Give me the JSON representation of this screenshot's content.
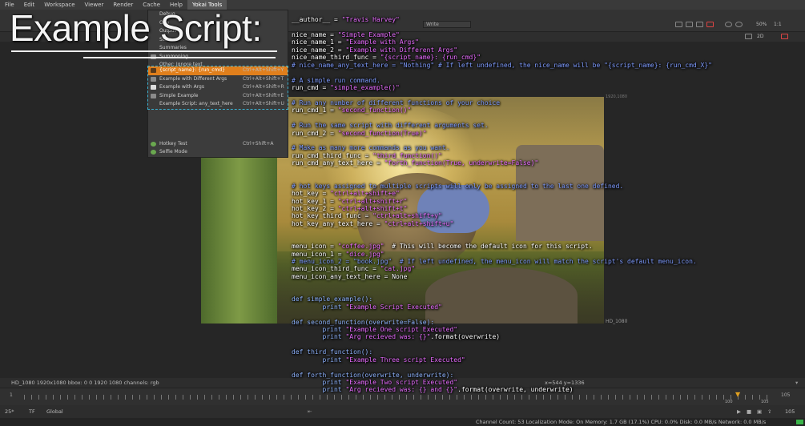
{
  "menubar": {
    "items": [
      "File",
      "Edit",
      "Workspace",
      "Viewer",
      "Render",
      "Cache",
      "Help",
      "Yokai Tools"
    ]
  },
  "overlay_title": "Example Script:",
  "dropdown": {
    "items": [
      "Debug",
      "One",
      "Output",
      "Stats",
      "Summaries",
      "Summoning",
      "Other: Ignore text"
    ]
  },
  "submenu": {
    "items": [
      {
        "label": "{script_name}: {run_cmd}",
        "shortcut": "Ctrl+Alt+Shift+Y"
      },
      {
        "label": "Example with Different Args",
        "shortcut": "Ctrl+Alt+Shift+T"
      },
      {
        "label": "Example with Args",
        "shortcut": "Ctrl+Alt+Shift+R"
      },
      {
        "label": "Simple Example",
        "shortcut": "Ctrl+Alt+Shift+E"
      },
      {
        "label": "Example Script: any_text_here",
        "shortcut": "Ctrl+Alt+Shift+U"
      }
    ],
    "extra": [
      {
        "label": "Hotkey Test",
        "shortcut": "Ctrl+Shift+A"
      },
      {
        "label": "Selfie Mode",
        "shortcut": ""
      }
    ]
  },
  "toolbar": {
    "write_label": "Write",
    "zoom": "50%",
    "ratio": "1:1",
    "view_mode": "2D"
  },
  "viewer": {
    "format_top": "1920,1080",
    "format_bottom": "HD_1080"
  },
  "code_lines": [
    "__author__ = \"Travis Harvey\"",
    "",
    "nice_name = \"Simple Example\"",
    "nice_name_1 = \"Example with Args\"",
    "nice_name_2 = \"Example with Different Args\"",
    "nice_name_third_func = \"{script_name}: {run_cmd}\"",
    "# nice_name_any_text_here = \"Nothing\" # If left undefined, the nice_name will be \"{script_name}: {run_cmd_X}\"",
    "",
    "# A simple run command.",
    "run_cmd = \"simple_example()\"",
    "",
    "# Run any number of different functions of your choice",
    "run_cmd_1 = \"second_function()\"",
    "",
    "# Run the same script with different arguments set.",
    "run_cmd_2 = \"second_function(True)\"",
    "",
    "# Make as many more commands as you want.",
    "run_cmd_third_func = \"third_function()\"",
    "run_cmd_any_text_here = \"forth_function(True, underwrite=False)\"",
    "",
    "",
    "# hot keys assigned to multiple scripts will only be assigned to the last one defined.",
    "hot_key = \"ctrl+alt+shift+e\"",
    "hot_key_1 = \"ctrl+alt+shift+r\"",
    "hot_key_2 = \"ctrl+alt+shift+t\"",
    "hot_key_third_func = \"ctrl+alt+shift+y\"",
    "hot_key_any_text_here = \"ctrl+alt+shift+u\"",
    "",
    "",
    "menu_icon = \"coffee.jpg\"  # This will become the default icon for this script.",
    "menu_icon_1 = \"dice.jpg\"",
    "# menu_icon_2 = \"book.jpg\"  # If left undefined, the menu_icon will match the script's default menu_icon.",
    "menu_icon_third_func = \"cat.jpg\"",
    "menu_icon_any_text_here = None",
    "",
    "",
    "def simple_example():",
    "        print \"Example Script Executed\"",
    "",
    "def second_function(overwrite=False):",
    "        print \"Example One script Executed\"",
    "        print \"Arg recieved was: {}\".format(overwrite)",
    "",
    "def third_function():",
    "        print \"Example Three script Executed\"",
    "",
    "def forth_function(overwrite, underwrite):",
    "        print \"Example Two script Executed\"",
    "        print \"Arg recieved was: {} and {}\".format(overwrite, underwrite)"
  ],
  "infobar": {
    "left": "HD_1080 1920x1080  bbox: 0 0 1920 1080 channels: rgb",
    "coords": "x=544 y=1336"
  },
  "timeline": {
    "start": "1",
    "end": "105",
    "mid": "100"
  },
  "bottombar": {
    "fps": "25*",
    "tf": "TF",
    "mode": "Global",
    "frame": "105"
  },
  "statusbar": {
    "text": "Channel Count: 53  Localization Mode: On  Memory: 1.7 GB (17.1%)  CPU: 0.0%  Disk: 0.0 MB/s  Network: 0.0 MB/s"
  }
}
